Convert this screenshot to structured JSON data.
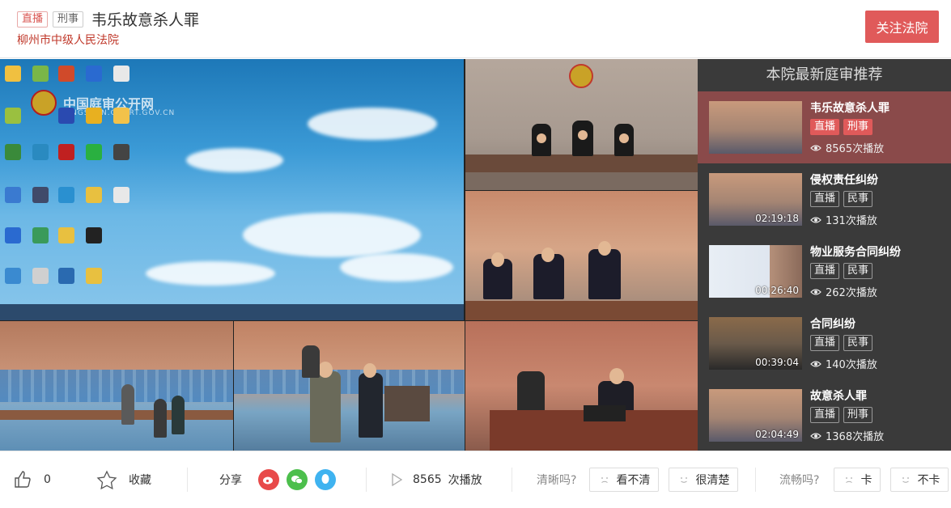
{
  "header": {
    "tag_live": "直播",
    "tag_type": "刑事",
    "title": "韦乐故意杀人罪",
    "court": "柳州市中级人民法院",
    "follow_label": "关注法院"
  },
  "player": {
    "watermark_cn": "中国庭审公开网",
    "watermark_en": "TINGSHEN.COURT.GOV.CN"
  },
  "sidebar": {
    "title": "本院最新庭审推荐",
    "items": [
      {
        "title": "韦乐故意杀人罪",
        "tag1": "直播",
        "tag2": "刑事",
        "plays": "8565次播放",
        "duration": ""
      },
      {
        "title": "侵权责任纠纷",
        "tag1": "直播",
        "tag2": "民事",
        "plays": "131次播放",
        "duration": "02:19:18"
      },
      {
        "title": "物业服务合同纠纷",
        "tag1": "直播",
        "tag2": "民事",
        "plays": "262次播放",
        "duration": "00:26:40"
      },
      {
        "title": "合同纠纷",
        "tag1": "直播",
        "tag2": "民事",
        "plays": "140次播放",
        "duration": "00:39:04"
      },
      {
        "title": "故意杀人罪",
        "tag1": "直播",
        "tag2": "刑事",
        "plays": "1368次播放",
        "duration": "02:04:49"
      }
    ]
  },
  "bottom": {
    "like_count": "0",
    "favorite_label": "收藏",
    "share_label": "分享",
    "play_count": "8565",
    "play_suffix": "次播放",
    "clarity_q": "清晰吗?",
    "unclear_label": "看不清",
    "clear_label": "很清楚",
    "smooth_q": "流畅吗?",
    "stuck_label": "卡",
    "smooth_label": "不卡"
  },
  "colors": {
    "accent": "#e05a5a",
    "active_item": "#8a4a4a",
    "sidebar_bg": "#3a3a3a"
  }
}
